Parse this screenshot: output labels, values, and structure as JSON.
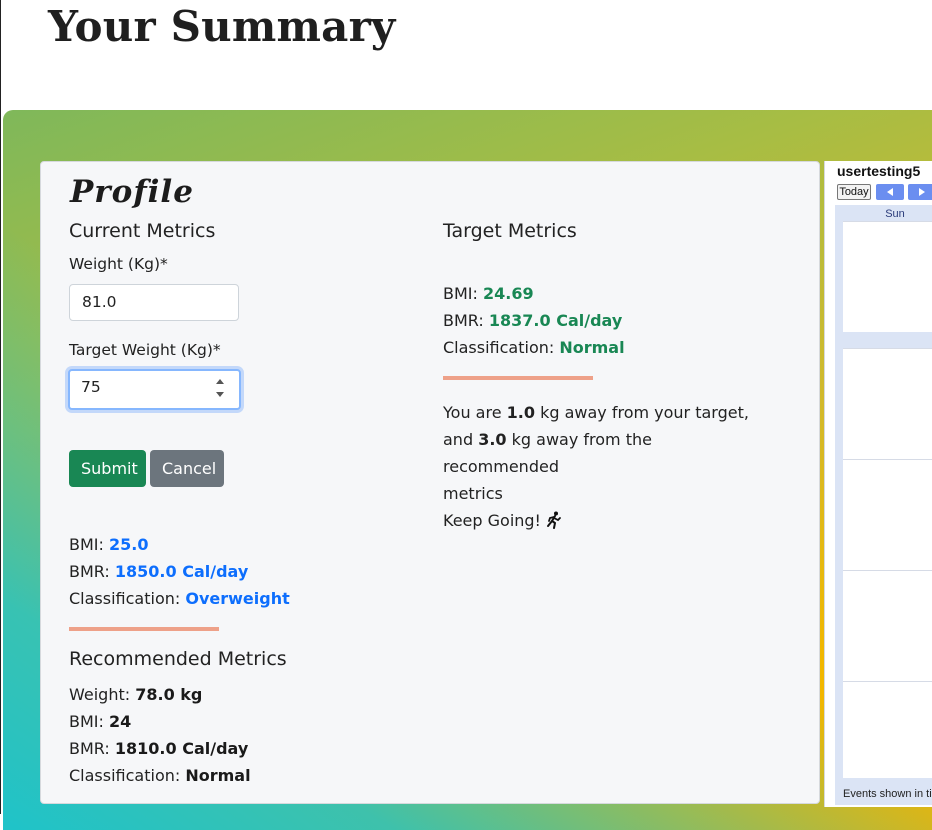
{
  "page": {
    "title": "Your Summary"
  },
  "profile": {
    "title": "Profile",
    "current_heading": "Current Metrics",
    "target_heading": "Target Metrics",
    "weight_label": "Weight (Kg)*",
    "weight_value": "81.0",
    "target_weight_label": "Target Weight (Kg)*",
    "target_weight_value": "75",
    "submit_label": "Submit",
    "cancel_label": "Cancel",
    "current": {
      "bmi_label": "BMI:",
      "bmi_value": "25.0",
      "bmr_label": "BMR:",
      "bmr_value": "1850.0 Cal/day",
      "class_label": "Classification:",
      "class_value": "Overweight"
    },
    "target": {
      "bmi_label": "BMI:",
      "bmi_value": "24.69",
      "bmr_label": "BMR:",
      "bmr_value": "1837.0 Cal/day",
      "class_label": "Classification:",
      "class_value": "Normal"
    },
    "recommended_heading": "Recommended Metrics",
    "recommended": {
      "weight_label": "Weight:",
      "weight_value": "78.0 kg",
      "bmi_label": "BMI:",
      "bmi_value": "24",
      "bmr_label": "BMR:",
      "bmr_value": "1810.0 Cal/day",
      "class_label": "Classification:",
      "class_value": "Normal"
    },
    "summary": {
      "line1_pre": "You are",
      "target_gap": "1.0",
      "line1_post": "kg away from your target,",
      "line2_pre": "and",
      "rec_gap": "3.0",
      "line2_post": "kg away from the recommended",
      "line3": "metrics",
      "line4": "Keep Going!"
    }
  },
  "calendar": {
    "user": "usertesting5",
    "today_label": "Today",
    "day_header": "Sun",
    "footer": "Events shown in ti"
  },
  "colors": {
    "current_value": "#0d6efd",
    "target_value": "#198754",
    "divider": "#eea189",
    "submit": "#198754",
    "cancel": "#6c757d"
  },
  "icons": {
    "runner": "person-running-icon"
  }
}
